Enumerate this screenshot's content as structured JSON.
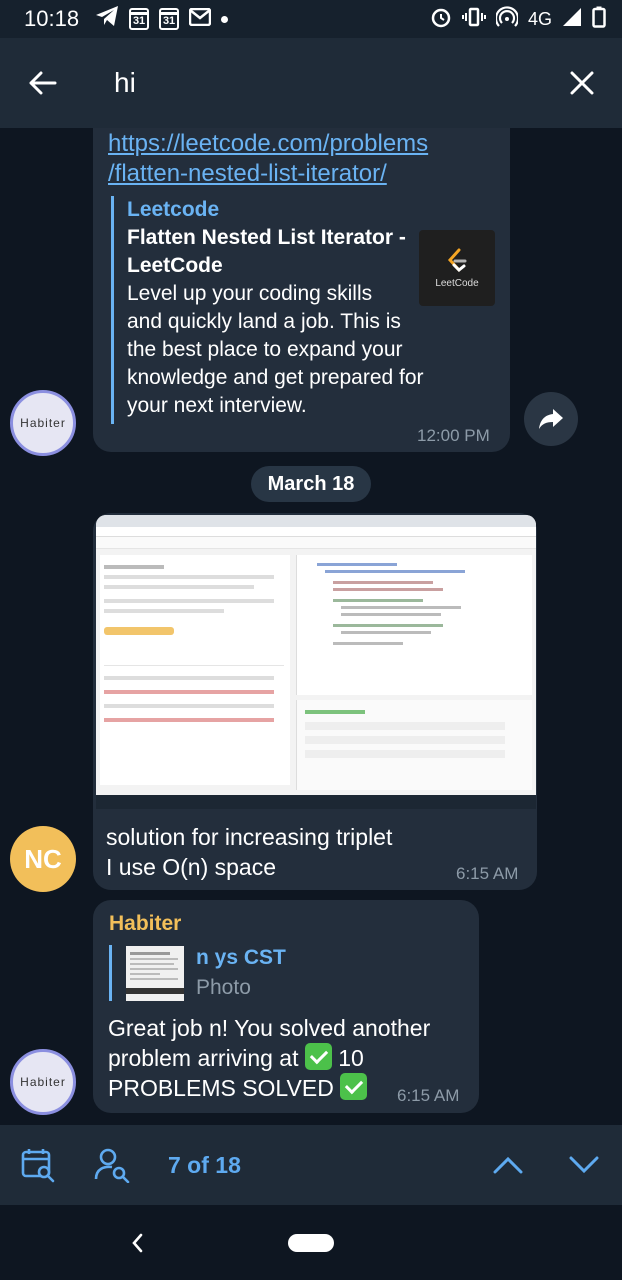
{
  "status_bar": {
    "time": "10:18",
    "calendar_day_1": "31",
    "calendar_day_2": "31",
    "network": "4G"
  },
  "header": {
    "search_query": "hi",
    "back_icon": "arrow-left-icon",
    "close_icon": "close-icon"
  },
  "messages": {
    "link_message": {
      "url_line1": "https://leetcode.com/problems",
      "url_line2": "/flatten-nested-list-iterator/",
      "preview_site": "Leetcode",
      "preview_title_line1": "Flatten Nested List Iterator -",
      "preview_title_line2": "LeetCode",
      "preview_desc_lines": [
        "Level up your coding skills",
        "and quickly land a job. This is",
        "the best place to expand your",
        "knowledge and get prepared for",
        "your next interview."
      ],
      "thumbnail_label": "LeetCode",
      "time": "12:00 PM",
      "sender_avatar": "Habiter"
    },
    "date_separator": "March 18",
    "photo_message": {
      "caption_line1": "solution for increasing triplet",
      "caption_line2": "I use O(n) space",
      "time": "6:15 AM",
      "sender_avatar": "NC"
    },
    "reply_message": {
      "sender": "Habiter",
      "reply_to_name": "n ys CST",
      "reply_to_type": "Photo",
      "text_line1": "Great job n! You solved another",
      "text_line2a": "problem arriving at",
      "text_line2b": "10",
      "text_line3": "PROBLEMS SOLVED",
      "time": "6:15 AM",
      "sender_avatar": "Habiter"
    }
  },
  "bottom_bar": {
    "counter": "7 of 18"
  },
  "colors": {
    "background": "#0e1621",
    "bubble": "#232e3c",
    "accent": "#6ab3f3",
    "sender_name": "#f2bf5a",
    "header": "#1f2b38"
  }
}
